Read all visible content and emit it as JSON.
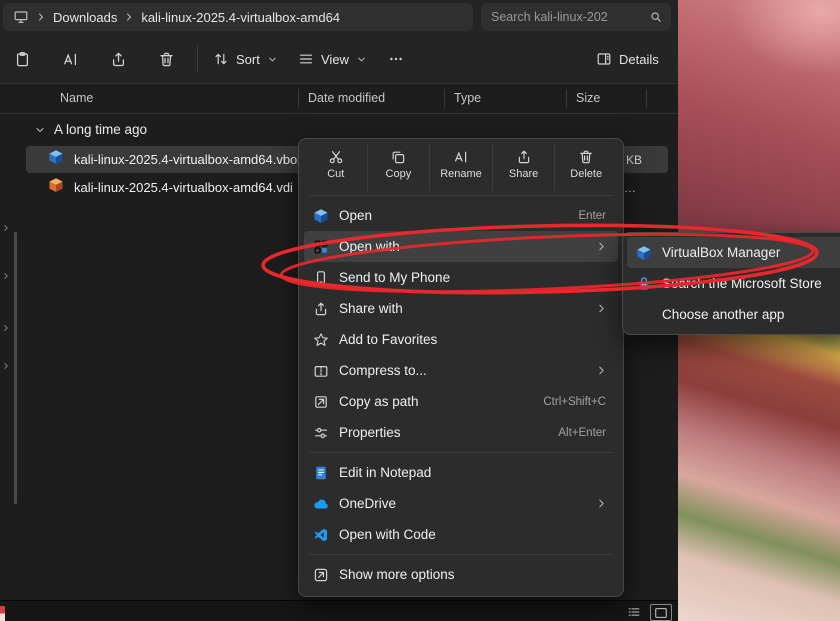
{
  "colors": {
    "annotation_red": "#e8282d",
    "selection_bg": "#3a3a3a",
    "menu_bg": "#2c2c2c"
  },
  "titlebar": {
    "crumbs": [
      "Downloads",
      "kali-linux-2025.4-virtualbox-amd64"
    ],
    "search_placeholder": "Search kali-linux-202"
  },
  "toolbar": {
    "sort": "Sort",
    "view": "View",
    "details": "Details"
  },
  "columns": {
    "name": "Name",
    "date_modified": "Date modified",
    "type": "Type",
    "size": "Size"
  },
  "filelist": {
    "group_label": "A long time ago",
    "files": [
      {
        "name": "kali-linux-2025.4-virtualbox-amd64.vbox",
        "size_visible": "KB"
      },
      {
        "name": "kali-linux-2025.4-virtualbox-amd64.vdi",
        "size_visible": "…"
      }
    ]
  },
  "context_menu": {
    "quick_actions": [
      {
        "label": "Cut"
      },
      {
        "label": "Copy"
      },
      {
        "label": "Rename"
      },
      {
        "label": "Share"
      },
      {
        "label": "Delete"
      }
    ],
    "items": [
      {
        "label": "Open",
        "shortcut": "Enter"
      },
      {
        "label": "Open with"
      },
      {
        "label": "Send to My Phone"
      },
      {
        "label": "Share with"
      },
      {
        "label": "Add to Favorites"
      },
      {
        "label": "Compress to..."
      },
      {
        "label": "Copy as path",
        "shortcut": "Ctrl+Shift+C"
      },
      {
        "label": "Properties",
        "shortcut": "Alt+Enter"
      },
      {
        "label": "Edit in Notepad"
      },
      {
        "label": "OneDrive"
      },
      {
        "label": "Open with Code"
      },
      {
        "label": "Show more options"
      }
    ]
  },
  "submenu": {
    "items": [
      {
        "label": "VirtualBox Manager"
      },
      {
        "label": "Search the Microsoft Store"
      },
      {
        "label": "Choose another app"
      }
    ]
  }
}
